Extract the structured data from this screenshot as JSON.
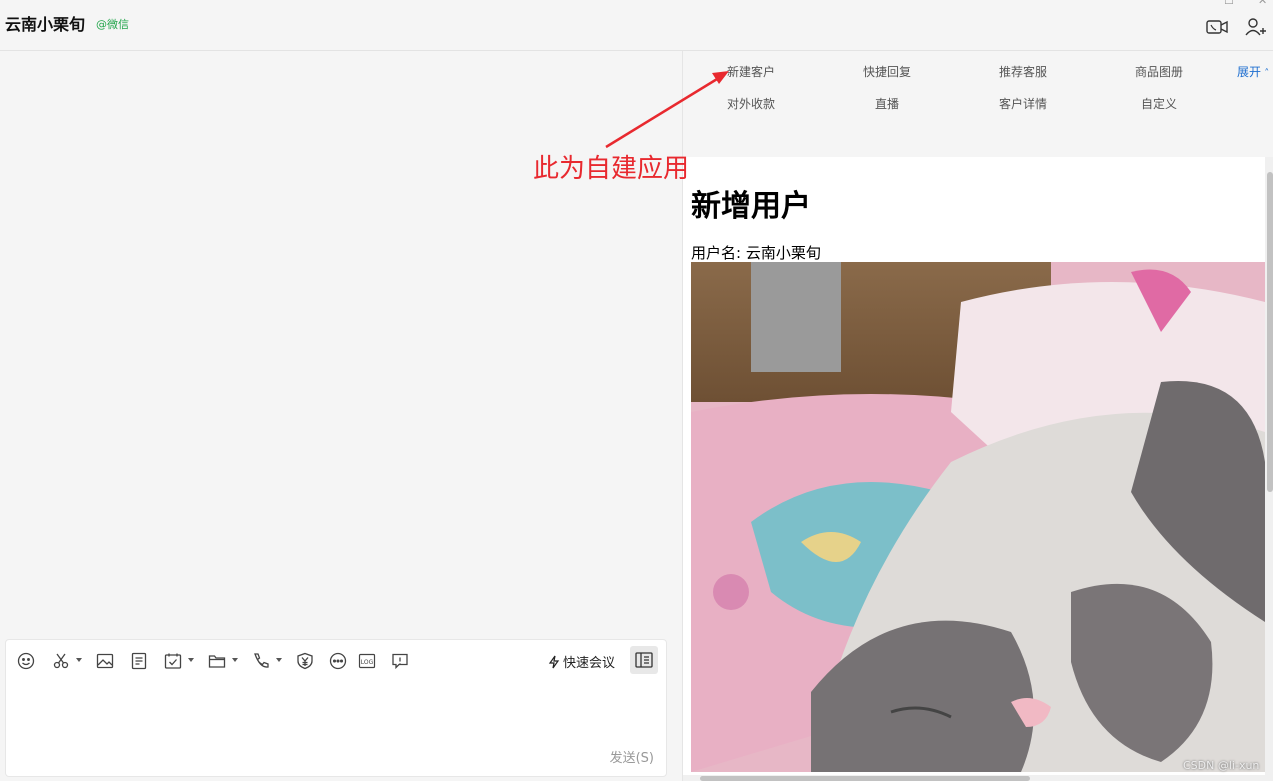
{
  "header": {
    "contact_name": "云南小栗旬",
    "contact_source": "@微信"
  },
  "toolbar": {
    "quick_meeting_label": "快速会议",
    "send_label": "发送(S)"
  },
  "apps": {
    "items": [
      {
        "label": "新建客户"
      },
      {
        "label": "快捷回复"
      },
      {
        "label": "推荐客服"
      },
      {
        "label": "商品图册"
      },
      {
        "label": "对外收款"
      },
      {
        "label": "直播"
      },
      {
        "label": "客户详情"
      },
      {
        "label": "自定义"
      }
    ],
    "expand_label": "展开"
  },
  "webview": {
    "title": "新增用户",
    "username_label": "用户名:",
    "username_value": "云南小栗旬"
  },
  "annotation": {
    "text": "此为自建应用",
    "color": "#e8292f"
  },
  "watermark": "CSDN @li-xun",
  "colors": {
    "accent_link": "#1f6fd0",
    "wechat_green": "#21a54a"
  }
}
